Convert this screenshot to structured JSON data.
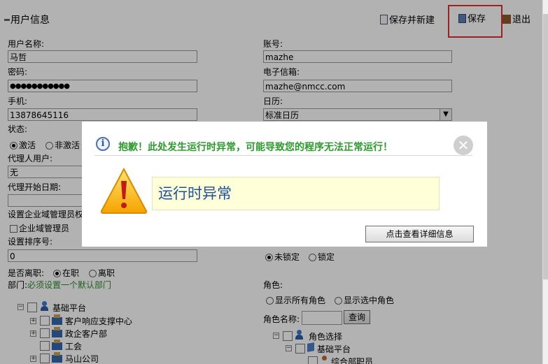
{
  "header": {
    "title": "用户信息",
    "save_new_label": "保存并新建",
    "save_label": "保存",
    "exit_label": "退出"
  },
  "form": {
    "username_label": "用户名称:",
    "username_value": "马哲",
    "account_label": "账号:",
    "account_value": "mazhe",
    "password_label": "密码:",
    "password_value": "●●●●●●●●●●●",
    "email_label": "电子信箱:",
    "email_value": "mazhe@nmcc.com",
    "phone_label": "手机:",
    "phone_value": "13878645116",
    "calendar_label": "日历:",
    "calendar_value": "标准日历",
    "status_label": "状态:",
    "status_active": "激活",
    "status_inactive": "非激活",
    "proxy_label": "代理人用户:",
    "proxy_value": "无",
    "proxy_date_label": "代理开始日期:",
    "admin_label": "设置企业域管理员权",
    "admin_check_label": "企业域管理员",
    "sort_label": "设置排序号:",
    "sort_value": "0",
    "lock_unlocked": "未锁定",
    "lock_locked": "锁定",
    "resigned_label": "是否离职:",
    "resigned_no": "在职",
    "resigned_yes": "离职",
    "dept_label": "部门:",
    "dept_hint": "必须设置一个默认部门",
    "role_label": "角色:",
    "role_show_all": "显示所有角色",
    "role_show_selected": "显示选中角色",
    "role_name_label": "角色名称:",
    "query_label": "查询"
  },
  "dept_tree": [
    "基础平台",
    "客户响应支撑中心",
    "政企客户部",
    "工会",
    "马山公司"
  ],
  "role_tree": [
    "角色选择",
    "基础平台",
    "综合部职员"
  ],
  "dialog": {
    "title": "抱歉！此处发生运行时异常，可能导致您的程序无法正常运行！",
    "message": "运行时异常",
    "detail_button": "点击查看详细信息",
    "close_glyph": "✕"
  },
  "colors": {
    "highlight_box": "#e03030",
    "title_green": "#2e9a2e",
    "message_blue": "#1c4f9c",
    "hint_green": "#2d8a2d"
  }
}
